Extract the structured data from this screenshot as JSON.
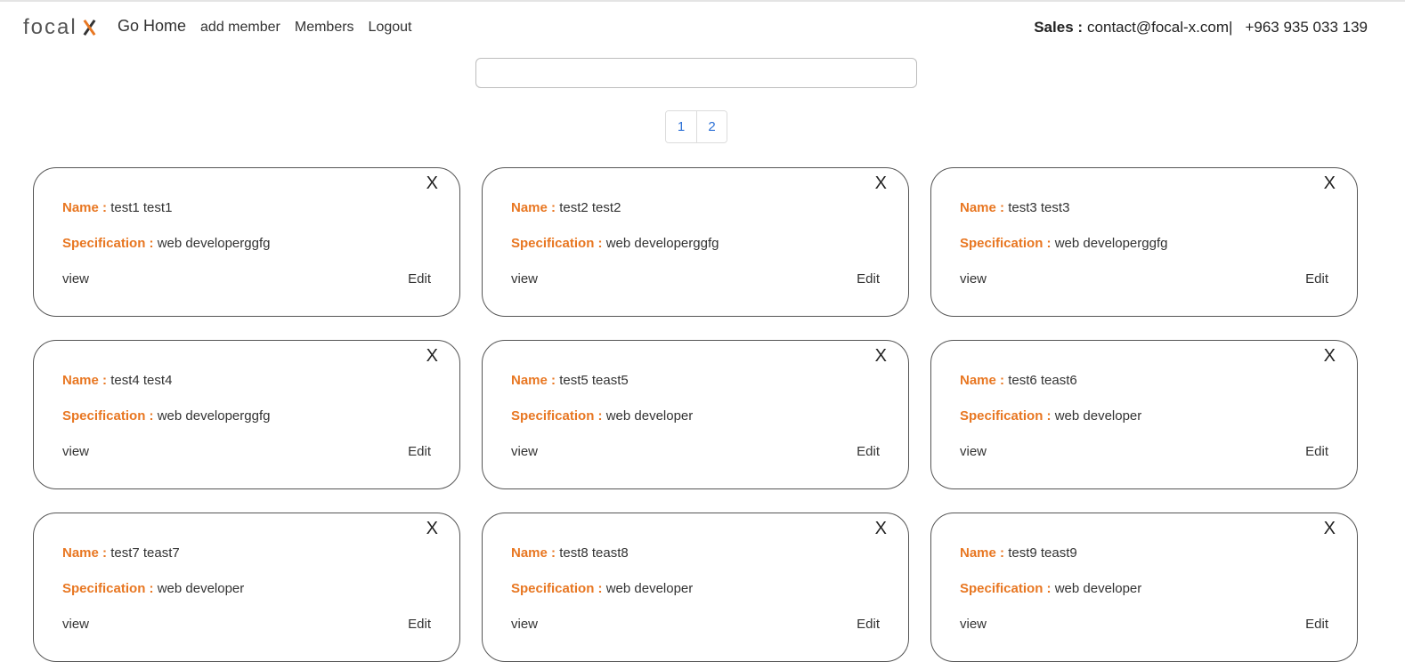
{
  "brand": {
    "text": "focal",
    "mark": "X-logo-icon"
  },
  "nav": {
    "home": "Go Home",
    "add_member": "add member",
    "members": "Members",
    "logout": "Logout"
  },
  "contact": {
    "label": "Sales :",
    "email": "contact@focal-x.com|",
    "phone": "+963 935 033 139"
  },
  "search": {
    "value": "",
    "placeholder": ""
  },
  "pagination": {
    "pages": [
      "1",
      "2"
    ]
  },
  "colors": {
    "accent": "#e87722",
    "link": "#2b6fd6"
  },
  "card_labels": {
    "name": "Name :",
    "spec": "Specification :",
    "view": "view",
    "edit": "Edit",
    "close": "X"
  },
  "members": [
    {
      "name": "test1 test1",
      "spec": "web developerggfg"
    },
    {
      "name": "test2 test2",
      "spec": "web developerggfg"
    },
    {
      "name": "test3 test3",
      "spec": "web developerggfg"
    },
    {
      "name": "test4 test4",
      "spec": "web developerggfg"
    },
    {
      "name": "test5 teast5",
      "spec": "web developer"
    },
    {
      "name": "test6 teast6",
      "spec": "web developer"
    },
    {
      "name": "test7 teast7",
      "spec": "web developer"
    },
    {
      "name": "test8 teast8",
      "spec": "web developer"
    },
    {
      "name": "test9 teast9",
      "spec": "web developer"
    }
  ]
}
